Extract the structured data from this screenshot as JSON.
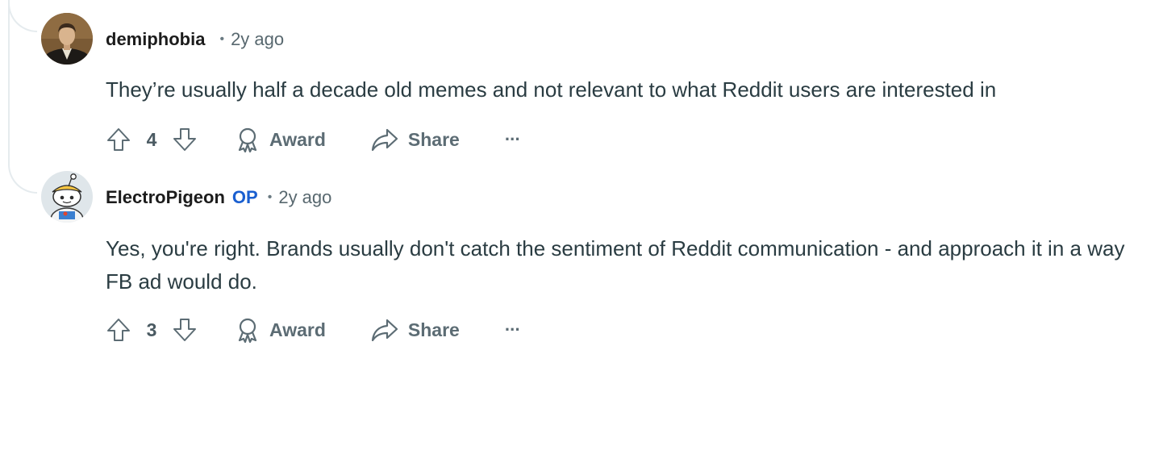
{
  "comments": [
    {
      "author": "demiphobia",
      "op_badge": "",
      "separator": "•",
      "time": "2y ago",
      "body": "They’re usually half a decade old memes and not relevant to what Reddit users are interested in",
      "votes": "4",
      "award_label": "Award",
      "share_label": "Share",
      "more_label": "···",
      "avatar": "portrait-avatar-icon"
    },
    {
      "author": "ElectroPigeon",
      "op_badge": "OP",
      "separator": "•",
      "time": "2y ago",
      "body": "Yes, you're right. Brands usually don't catch the sentiment of Reddit communication - and approach it in a way FB ad would do.",
      "votes": "3",
      "award_label": "Award",
      "share_label": "Share",
      "more_label": "···",
      "avatar": "snoo-avatar-icon"
    }
  ],
  "colors": {
    "op": "#1a5fd0",
    "action_text": "#5c6c74",
    "thread_line": "#e5ebee"
  }
}
